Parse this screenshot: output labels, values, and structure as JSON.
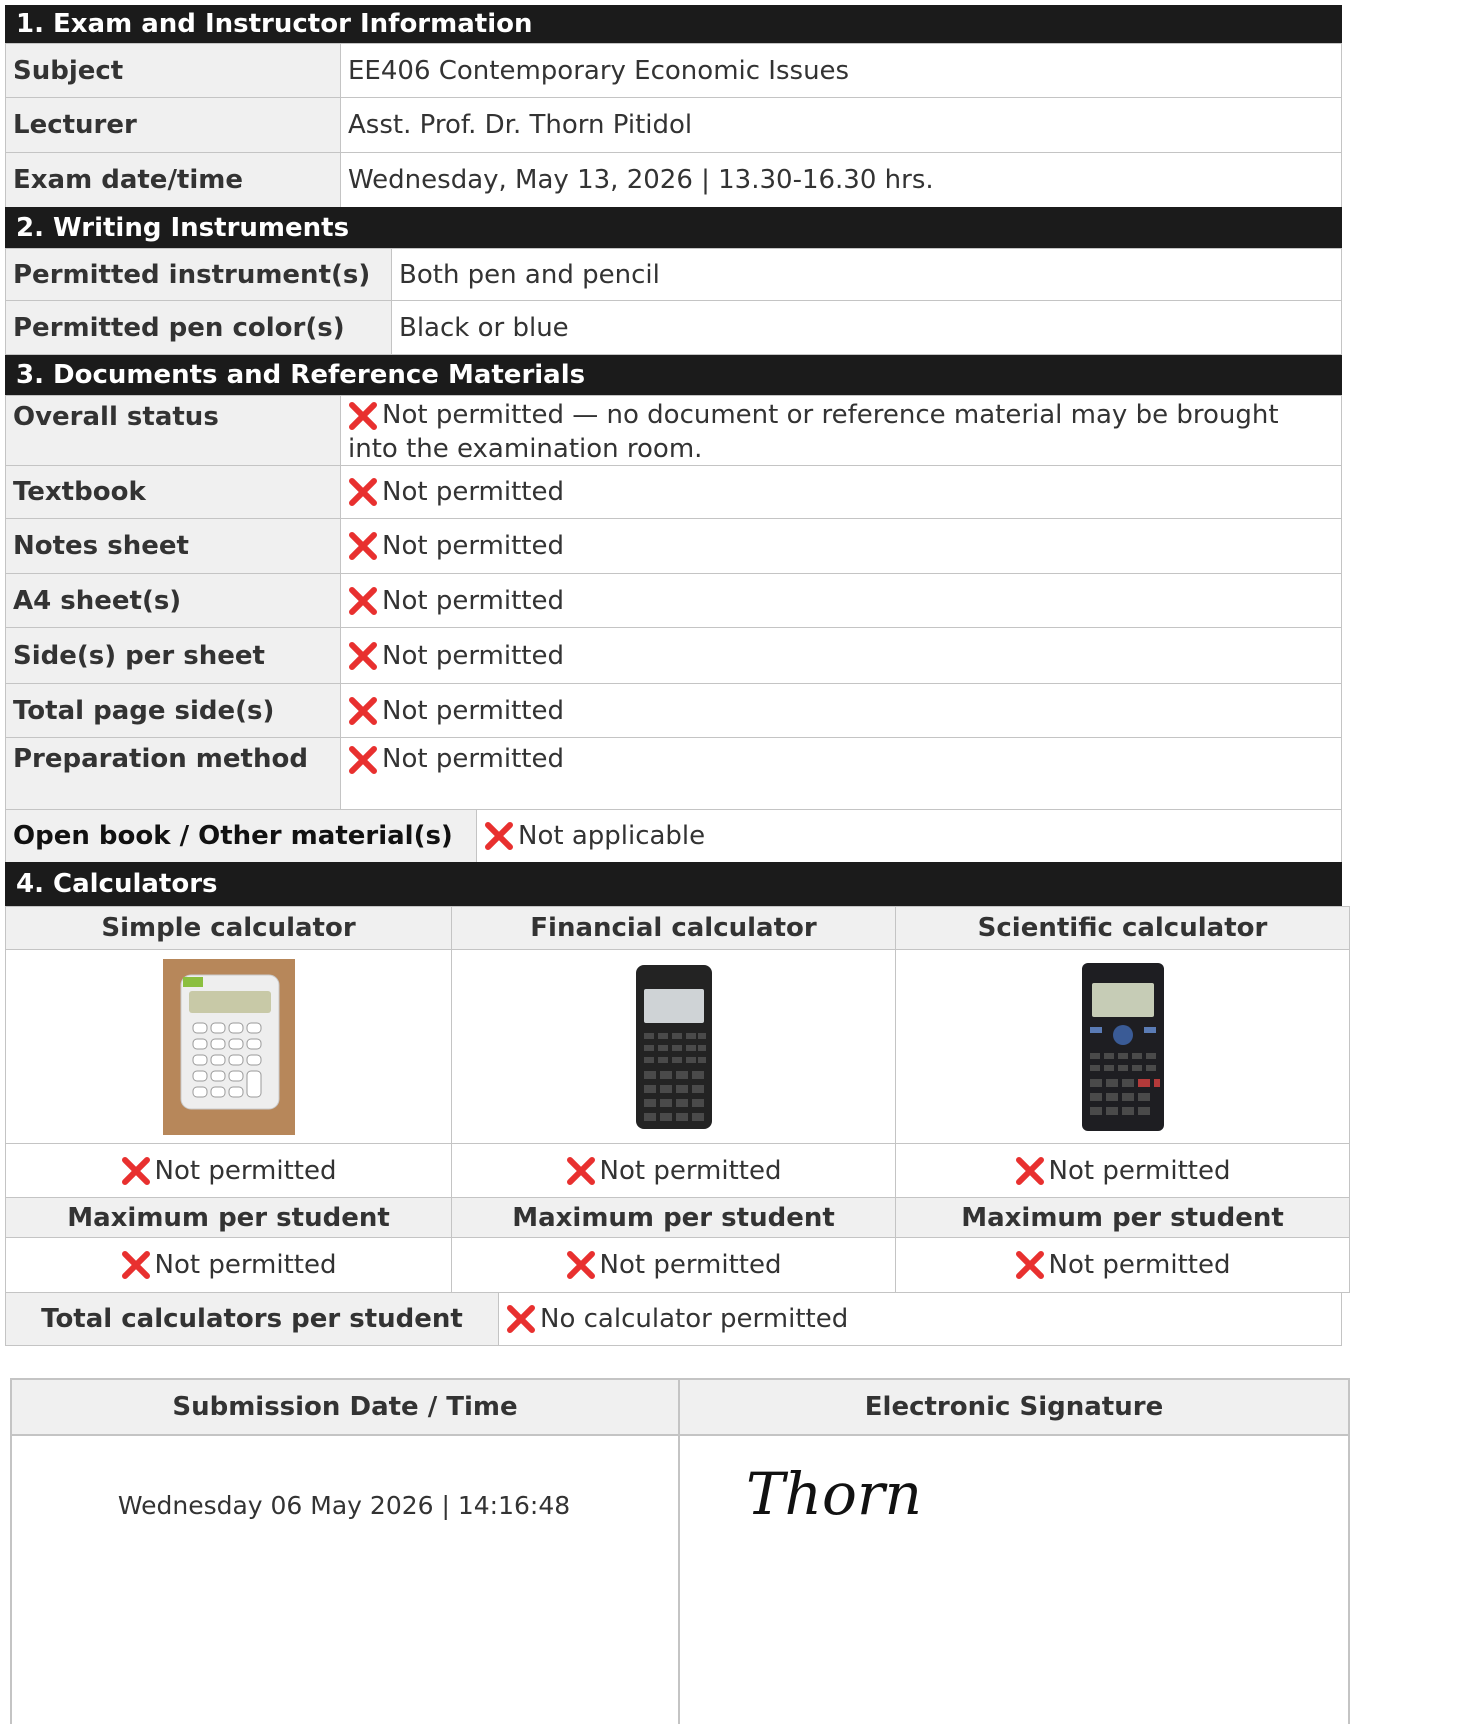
{
  "sections": {
    "s1": "1. Exam and Instructor Information",
    "s2": "2. Writing Instruments",
    "s3": "3. Documents and Reference Materials",
    "s4": "4. Calculators"
  },
  "exam": {
    "subject_label": "Subject",
    "subject": "EE406 Contemporary Economic Issues",
    "lecturer_label": "Lecturer",
    "lecturer": "Asst. Prof. Dr. Thorn Pitidol",
    "datetime_label": "Exam date/time",
    "datetime": "Wednesday, May 13, 2026 | 13.30-16.30 hrs."
  },
  "writing": {
    "instrument_label": "Permitted instrument(s)",
    "instrument": "Both pen and pencil",
    "color_label": "Permitted pen color(s)",
    "color": "Black or blue"
  },
  "documents": {
    "overall_label": "Overall status",
    "overall": "Not permitted — no document or reference material may be brought into the examination room.",
    "textbook_label": "Textbook",
    "textbook": "Not permitted",
    "notes_label": "Notes sheet",
    "notes": "Not permitted",
    "a4_label": "A4 sheet(s)",
    "a4": "Not permitted",
    "sides_label": "Side(s) per sheet",
    "sides": "Not permitted",
    "total_label": "Total page side(s)",
    "total": "Not permitted",
    "prep_label": "Preparation method",
    "prep": "Not permitted",
    "open_label": "Open book / Other material(s)",
    "open": "Not applicable"
  },
  "calculators": {
    "simple": "Simple calculator",
    "financial": "Financial calculator",
    "scientific": "Scientific calculator",
    "simple_status": "Not permitted",
    "financial_status": "Not permitted",
    "scientific_status": "Not permitted",
    "max_label": "Maximum per student",
    "simple_max": "Not permitted",
    "financial_max": "Not permitted",
    "scientific_max": "Not permitted",
    "total_label": "Total calculators per student",
    "total": "No calculator permitted"
  },
  "submission": {
    "date_label": "Submission Date / Time",
    "sig_label": "Electronic Signature",
    "date": "Wednesday 06 May 2026 | 14:16:48",
    "signature": "Thorn"
  },
  "icons": {
    "status": "cross-mark-icon"
  },
  "colors": {
    "header": "#1b1b1b",
    "cross": "#e8302f",
    "label_bg": "#f0f0f0"
  }
}
